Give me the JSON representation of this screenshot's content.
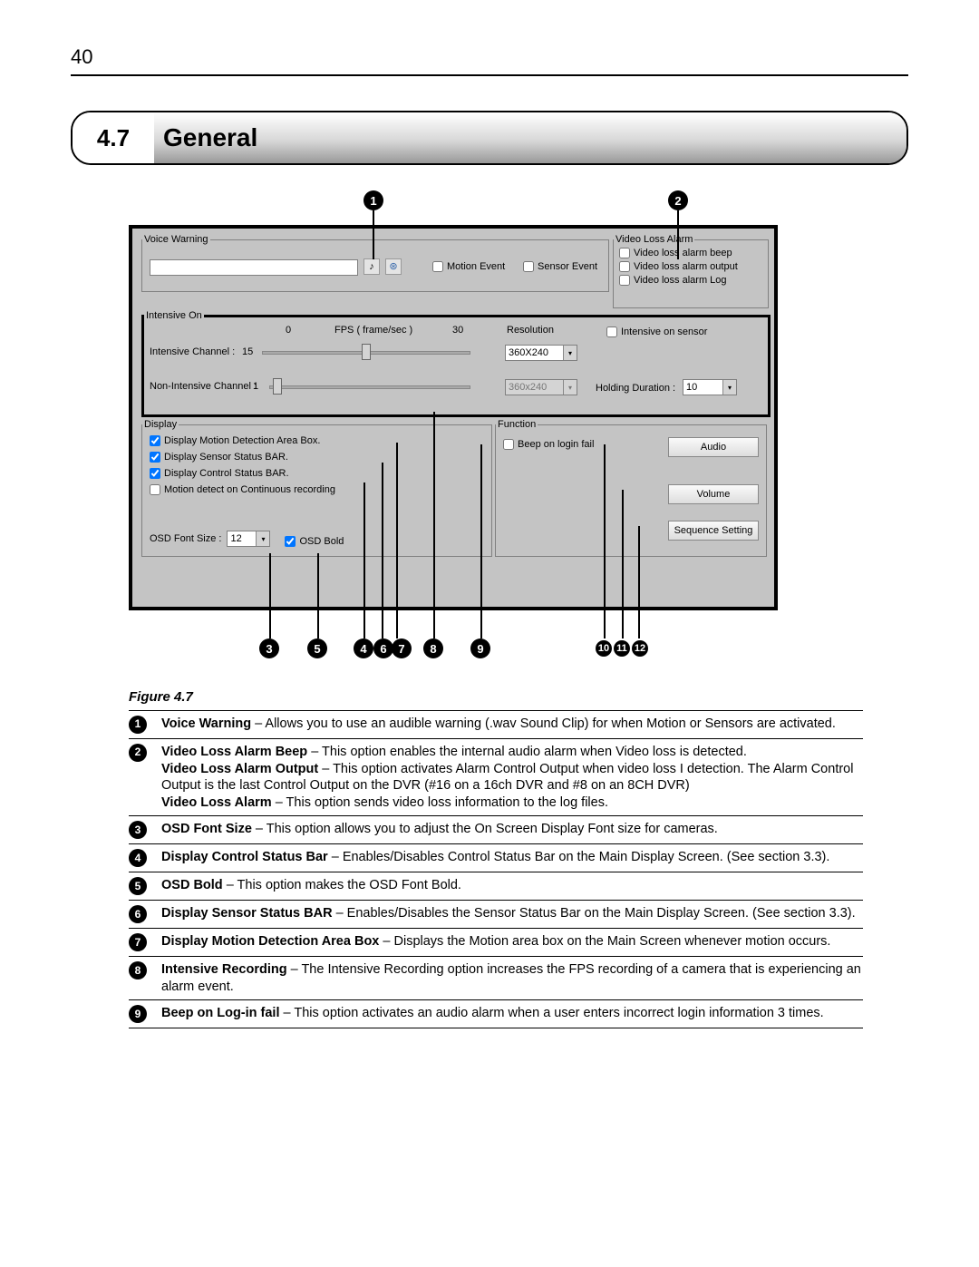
{
  "page_number": "40",
  "section": {
    "number": "4.7",
    "title": "General"
  },
  "shot": {
    "voice_warning": {
      "legend": "Voice Warning",
      "path_value": "",
      "motion_event": "Motion Event",
      "sensor_event": "Sensor Event"
    },
    "video_loss_alarm": {
      "legend": "Video Loss Alarm",
      "beep": "Video loss alarm beep",
      "output": "Video loss alarm output",
      "log": "Video loss alarm Log"
    },
    "intensive": {
      "legend": "Intensive On",
      "scale_min": "0",
      "scale_label": "FPS ( frame/sec )",
      "scale_max": "30",
      "intensive_channel_label": "Intensive Channel :",
      "intensive_channel_value": "15",
      "nonintensive_channel_label": "Non-Intensive Channel :",
      "nonintensive_channel_value": "1",
      "resolution_label": "Resolution",
      "resolution_value": "360X240",
      "resolution_value2": "360x240",
      "intensive_on_sensor": "Intensive on sensor",
      "holding_duration_label": "Holding Duration :",
      "holding_duration_value": "10"
    },
    "display": {
      "legend": "Display",
      "motion_box": "Display Motion Detection Area Box.",
      "sensor_bar": "Display Sensor Status BAR.",
      "control_bar": "Display Control Status BAR.",
      "motion_cont": "Motion detect on Continuous recording",
      "osd_font_label": "OSD Font Size :",
      "osd_font_value": "12",
      "osd_bold": "OSD Bold"
    },
    "function": {
      "legend": "Function",
      "beep_login": "Beep on login fail",
      "audio_btn": "Audio",
      "volume_btn": "Volume",
      "sequence_btn": "Sequence Setting"
    }
  },
  "figure_caption": "Figure 4.7",
  "callouts": {
    "c1": "1",
    "c2": "2",
    "c3": "3",
    "c4": "4",
    "c5": "5",
    "c6": "6",
    "c7": "7",
    "c8": "8",
    "c9": "9",
    "c10": "10",
    "c11": "11",
    "c12": "12"
  },
  "descriptions": [
    {
      "num": "1",
      "html": "<b>Voice Warning</b> – Allows you to use an audible warning (.wav Sound Clip) for when Motion or Sensors are activated."
    },
    {
      "num": "2",
      "html": "<b>Video Loss Alarm Beep</b> – This option enables the internal audio alarm when Video loss is detected.<br><b>Video Loss Alarm Output</b> – This option activates Alarm Control Output when video loss I detection. The Alarm Control Output is the last Control Output on the DVR (#16 on a 16ch DVR and #8 on an 8CH DVR)<br><b>Video Loss Alarm</b> – This option sends video loss information to the log files."
    },
    {
      "num": "3",
      "html": "<b>OSD Font Size</b> – This option allows you to adjust the On Screen Display Font size for cameras."
    },
    {
      "num": "4",
      "html": "<b>Display Control Status Bar</b> – Enables/Disables Control Status Bar on the Main Display Screen. (See section 3.3)."
    },
    {
      "num": "5",
      "html": "<b>OSD Bold</b> – This option makes the OSD Font Bold."
    },
    {
      "num": "6",
      "html": "<b>Display Sensor Status BAR</b> – Enables/Disables the Sensor Status Bar on the Main Display Screen. (See section 3.3)."
    },
    {
      "num": "7",
      "html": "<b>Display Motion Detection Area Box</b> – Displays the Motion area box on the Main Screen whenever motion occurs."
    },
    {
      "num": "8",
      "html": "<b>Intensive Recording</b> – The Intensive Recording option increases the FPS recording of a camera that is experiencing an alarm event."
    },
    {
      "num": "9",
      "html": "<b>Beep on Log-in fail</b> – This option activates an audio alarm when a user enters incorrect login information 3 times."
    }
  ]
}
